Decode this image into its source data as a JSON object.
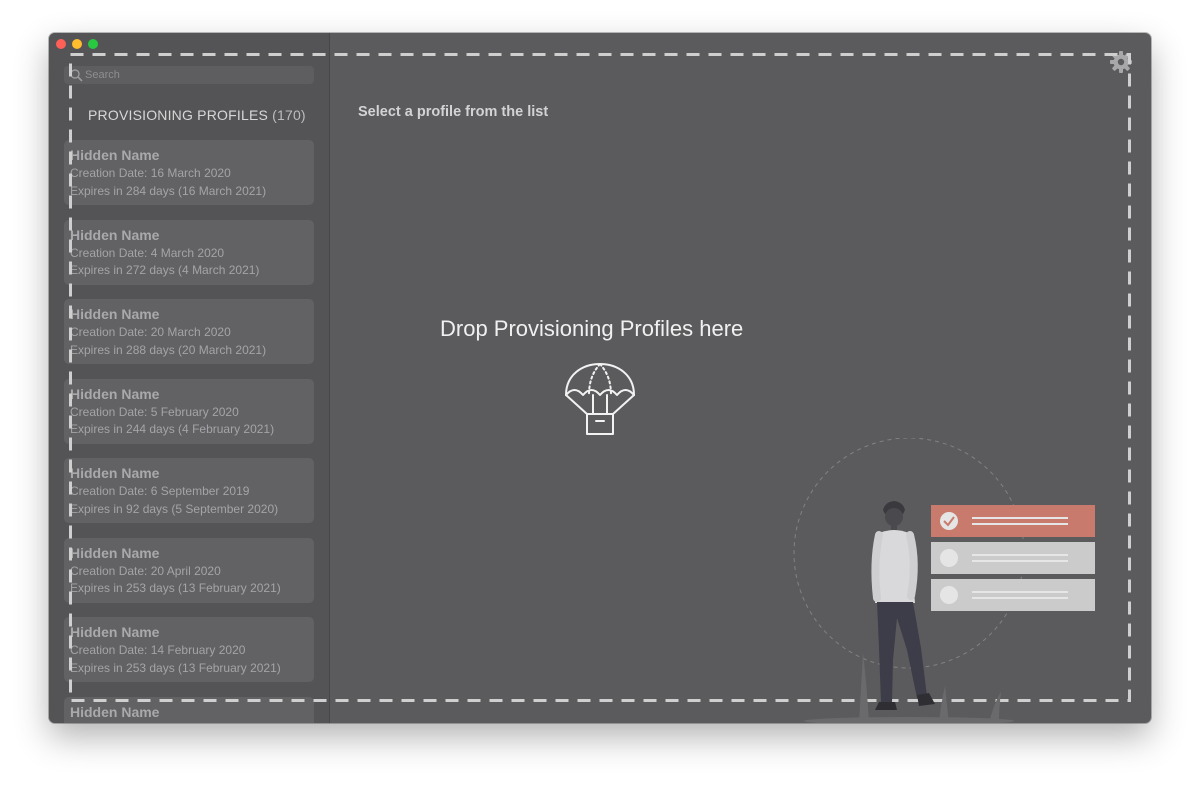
{
  "window": {
    "traffic_lights": {
      "close": "#fe5f57",
      "minimize": "#febc2e",
      "maximize": "#28c840"
    }
  },
  "sidebar": {
    "search_placeholder": "Search",
    "section_title": "PROVISIONING PROFILES",
    "section_count": "(170)",
    "profiles": [
      {
        "name": "Hidden Name",
        "created": "Creation Date: 16 March 2020",
        "expires": "Expires in 284 days (16 March 2021)"
      },
      {
        "name": "Hidden Name",
        "created": "Creation Date: 4 March 2020",
        "expires": "Expires in 272 days (4 March 2021)"
      },
      {
        "name": "Hidden Name",
        "created": "Creation Date: 20 March 2020",
        "expires": "Expires in 288 days (20 March 2021)"
      },
      {
        "name": "Hidden Name",
        "created": "Creation Date: 5 February 2020",
        "expires": "Expires in 244 days (4 February 2021)"
      },
      {
        "name": "Hidden Name",
        "created": "Creation Date: 6 September 2019",
        "expires": "Expires in 92 days (5 September 2020)"
      },
      {
        "name": "Hidden Name",
        "created": "Creation Date: 20 April 2020",
        "expires": "Expires in 253 days (13 February 2021)"
      },
      {
        "name": "Hidden Name",
        "created": "Creation Date: 14 February 2020",
        "expires": "Expires in 253 days (13 February 2021)"
      },
      {
        "name": "Hidden Name",
        "created": "",
        "expires": ""
      }
    ]
  },
  "main": {
    "title": "Select a profile from the list",
    "drop_text": "Drop Provisioning Profiles here",
    "icons": {
      "settings": "gear-icon",
      "drop": "parachute-box-icon",
      "illustration": "person-checklist-illustration"
    }
  },
  "colors": {
    "window_bg": "#5b5b5e",
    "sidebar_bg": "#545457",
    "card_bg": "#626265",
    "accent_checked": "#c87a6c",
    "unchecked_row": "#cbcbcb"
  }
}
